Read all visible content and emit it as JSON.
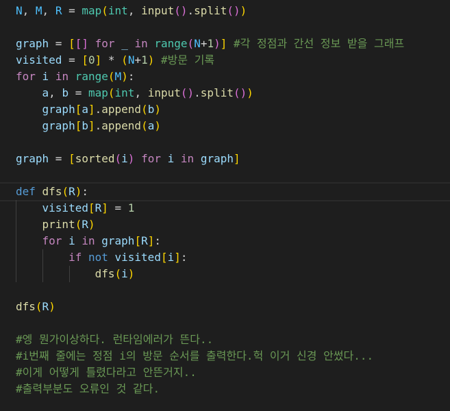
{
  "code": {
    "language": "python",
    "lines": [
      [
        [
          "N",
          "c"
        ],
        [
          ", ",
          "p"
        ],
        [
          "M",
          "c"
        ],
        [
          ", ",
          "p"
        ],
        [
          "R",
          "c"
        ],
        [
          " = ",
          "p"
        ],
        [
          "map",
          "t"
        ],
        [
          "(",
          "b1"
        ],
        [
          "int",
          "t"
        ],
        [
          ", ",
          "p"
        ],
        [
          "input",
          "f"
        ],
        [
          "(",
          "b2"
        ],
        [
          ")",
          "b2"
        ],
        [
          ".",
          "p"
        ],
        [
          "split",
          "f"
        ],
        [
          "(",
          "b2"
        ],
        [
          ")",
          "b2"
        ],
        [
          ")",
          "b1"
        ]
      ],
      [],
      [
        [
          "graph",
          "v"
        ],
        [
          " = ",
          "p"
        ],
        [
          "[",
          "b1"
        ],
        [
          "[",
          "b2"
        ],
        [
          "]",
          "b2"
        ],
        [
          " ",
          "p"
        ],
        [
          "for",
          "k"
        ],
        [
          " ",
          "p"
        ],
        [
          "_",
          "v"
        ],
        [
          " ",
          "p"
        ],
        [
          "in",
          "k"
        ],
        [
          " ",
          "p"
        ],
        [
          "range",
          "t"
        ],
        [
          "(",
          "b2"
        ],
        [
          "N",
          "c"
        ],
        [
          "+",
          "p"
        ],
        [
          "1",
          "n"
        ],
        [
          ")",
          "b2"
        ],
        [
          "]",
          "b1"
        ],
        [
          " #각 정점과 간선 정보 받을 그래프",
          "m"
        ]
      ],
      [
        [
          "visited",
          "v"
        ],
        [
          " = ",
          "p"
        ],
        [
          "[",
          "b1"
        ],
        [
          "0",
          "n"
        ],
        [
          "]",
          "b1"
        ],
        [
          " * ",
          "p"
        ],
        [
          "(",
          "b1"
        ],
        [
          "N",
          "c"
        ],
        [
          "+",
          "p"
        ],
        [
          "1",
          "n"
        ],
        [
          ")",
          "b1"
        ],
        [
          " #방문 기록",
          "m"
        ]
      ],
      [
        [
          "for",
          "k"
        ],
        [
          " ",
          "p"
        ],
        [
          "i",
          "v"
        ],
        [
          " ",
          "p"
        ],
        [
          "in",
          "k"
        ],
        [
          " ",
          "p"
        ],
        [
          "range",
          "t"
        ],
        [
          "(",
          "b1"
        ],
        [
          "M",
          "c"
        ],
        [
          ")",
          "b1"
        ],
        [
          ":",
          "p"
        ]
      ],
      [
        [
          "    ",
          "p"
        ],
        [
          "a",
          "v"
        ],
        [
          ", ",
          "p"
        ],
        [
          "b",
          "v"
        ],
        [
          " = ",
          "p"
        ],
        [
          "map",
          "t"
        ],
        [
          "(",
          "b1"
        ],
        [
          "int",
          "t"
        ],
        [
          ", ",
          "p"
        ],
        [
          "input",
          "f"
        ],
        [
          "(",
          "b2"
        ],
        [
          ")",
          "b2"
        ],
        [
          ".",
          "p"
        ],
        [
          "split",
          "f"
        ],
        [
          "(",
          "b2"
        ],
        [
          ")",
          "b2"
        ],
        [
          ")",
          "b1"
        ]
      ],
      [
        [
          "    ",
          "p"
        ],
        [
          "graph",
          "v"
        ],
        [
          "[",
          "b1"
        ],
        [
          "a",
          "v"
        ],
        [
          "]",
          "b1"
        ],
        [
          ".",
          "p"
        ],
        [
          "append",
          "f"
        ],
        [
          "(",
          "b1"
        ],
        [
          "b",
          "v"
        ],
        [
          ")",
          "b1"
        ]
      ],
      [
        [
          "    ",
          "p"
        ],
        [
          "graph",
          "v"
        ],
        [
          "[",
          "b1"
        ],
        [
          "b",
          "v"
        ],
        [
          "]",
          "b1"
        ],
        [
          ".",
          "p"
        ],
        [
          "append",
          "f"
        ],
        [
          "(",
          "b1"
        ],
        [
          "a",
          "v"
        ],
        [
          ")",
          "b1"
        ]
      ],
      [],
      [
        [
          "graph",
          "v"
        ],
        [
          " = ",
          "p"
        ],
        [
          "[",
          "b1"
        ],
        [
          "sorted",
          "f"
        ],
        [
          "(",
          "b2"
        ],
        [
          "i",
          "v"
        ],
        [
          ")",
          "b2"
        ],
        [
          " ",
          "p"
        ],
        [
          "for",
          "k"
        ],
        [
          " ",
          "p"
        ],
        [
          "i",
          "v"
        ],
        [
          " ",
          "p"
        ],
        [
          "in",
          "k"
        ],
        [
          " ",
          "p"
        ],
        [
          "graph",
          "v"
        ],
        [
          "]",
          "b1"
        ]
      ],
      [],
      [
        [
          "def",
          "s"
        ],
        [
          " ",
          "p"
        ],
        [
          "dfs",
          "f"
        ],
        [
          "(",
          "b1"
        ],
        [
          "R",
          "v"
        ],
        [
          ")",
          "b1"
        ],
        [
          ":",
          "p"
        ]
      ],
      [
        [
          "    ",
          "p"
        ],
        [
          "visited",
          "v"
        ],
        [
          "[",
          "b1"
        ],
        [
          "R",
          "v"
        ],
        [
          "]",
          "b1"
        ],
        [
          " = ",
          "p"
        ],
        [
          "1",
          "n"
        ]
      ],
      [
        [
          "    ",
          "p"
        ],
        [
          "print",
          "f"
        ],
        [
          "(",
          "b1"
        ],
        [
          "R",
          "v"
        ],
        [
          ")",
          "b1"
        ]
      ],
      [
        [
          "    ",
          "p"
        ],
        [
          "for",
          "k"
        ],
        [
          " ",
          "p"
        ],
        [
          "i",
          "v"
        ],
        [
          " ",
          "p"
        ],
        [
          "in",
          "k"
        ],
        [
          " ",
          "p"
        ],
        [
          "graph",
          "v"
        ],
        [
          "[",
          "b1"
        ],
        [
          "R",
          "v"
        ],
        [
          "]",
          "b1"
        ],
        [
          ":",
          "p"
        ]
      ],
      [
        [
          "        ",
          "p"
        ],
        [
          "if",
          "k"
        ],
        [
          " ",
          "p"
        ],
        [
          "not",
          "s"
        ],
        [
          " ",
          "p"
        ],
        [
          "visited",
          "v"
        ],
        [
          "[",
          "b1"
        ],
        [
          "i",
          "v"
        ],
        [
          "]",
          "b1"
        ],
        [
          ":",
          "p"
        ]
      ],
      [
        [
          "            ",
          "p"
        ],
        [
          "dfs",
          "f"
        ],
        [
          "(",
          "b1"
        ],
        [
          "i",
          "v"
        ],
        [
          ")",
          "b1"
        ]
      ],
      [],
      [
        [
          "dfs",
          "f"
        ],
        [
          "(",
          "b1"
        ],
        [
          "R",
          "v"
        ],
        [
          ")",
          "b1"
        ]
      ],
      [],
      [
        [
          "#엥 뭔가이상하다. 런타임에러가 뜬다..",
          "m"
        ]
      ],
      [
        [
          "#i번째 줄에는 정점 i의 방문 순서를 출력한다.헉 이거 신경 안썼다...",
          "m"
        ]
      ],
      [
        [
          "#이게 어떻게 틀렸다라고 안뜬거지..",
          "m"
        ]
      ],
      [
        [
          "#출력부분도 오류인 것 같다.",
          "m"
        ]
      ]
    ]
  }
}
